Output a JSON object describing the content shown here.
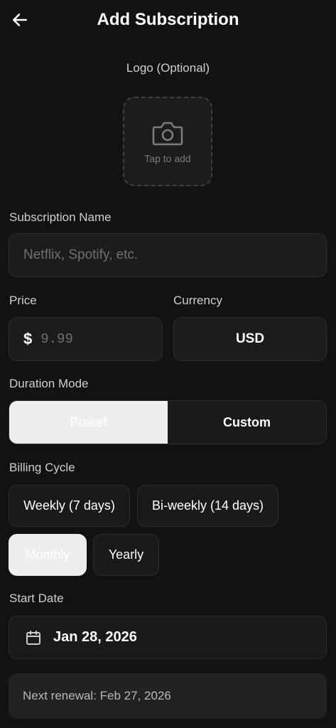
{
  "header": {
    "title": "Add Subscription"
  },
  "logo": {
    "label": "Logo (Optional)",
    "tap_text": "Tap to add"
  },
  "name": {
    "label": "Subscription Name",
    "placeholder": "Netflix, Spotify, etc.",
    "value": ""
  },
  "price": {
    "label": "Price",
    "symbol": "$",
    "placeholder": "9.99",
    "value": ""
  },
  "currency": {
    "label": "Currency",
    "value": "USD"
  },
  "duration_mode": {
    "label": "Duration Mode",
    "options": [
      "Preset",
      "Custom"
    ],
    "selected": "Preset"
  },
  "billing_cycle": {
    "label": "Billing Cycle",
    "options": [
      "Weekly (7 days)",
      "Bi-weekly (14 days)",
      "Monthly",
      "Yearly"
    ],
    "selected": "Monthly"
  },
  "start_date": {
    "label": "Start Date",
    "value": "Jan 28, 2026"
  },
  "renewal": {
    "text": "Next renewal: Feb 27, 2026"
  },
  "icons": {
    "back": "arrow-left-icon",
    "camera": "camera-icon",
    "calendar": "calendar-icon"
  },
  "colors": {
    "background": "#121212",
    "surface": "#1c1c1c",
    "border": "#2e2e2e",
    "selected": "#eeeeee",
    "muted_text": "#cfcfcf"
  }
}
